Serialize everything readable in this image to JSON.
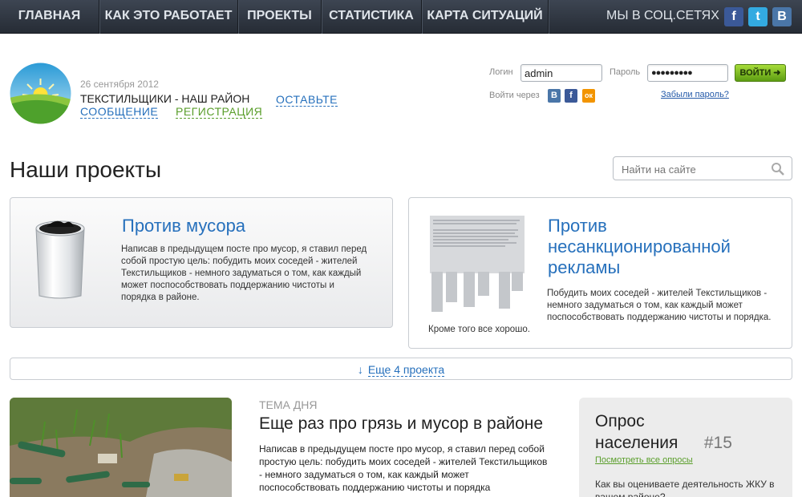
{
  "nav": {
    "items": [
      "ГЛАВНАЯ",
      "КАК ЭТО РАБОТАЕТ",
      "ПРОЕКТЫ",
      "СТАТИСТИКА",
      "КАРТА СИТУАЦИЙ"
    ],
    "social_label": "МЫ В СОЦ.СЕТЯХ",
    "social_icons": [
      {
        "name": "facebook-icon",
        "glyph": "f",
        "color": "#3b5998"
      },
      {
        "name": "twitter-icon",
        "glyph": "t",
        "color": "#33aae1"
      },
      {
        "name": "vkontakte-icon",
        "glyph": "B",
        "color": "#4a76a8"
      }
    ]
  },
  "header": {
    "date": "26 сентября 2012",
    "site_title": "ТЕКСТИЛЬЩИКИ - НАШ РАЙОН",
    "leave_label": "ОСТАВЬТЕ",
    "message_label": "СООБЩЕНИЕ",
    "register_label": "РЕГИСТРАЦИЯ"
  },
  "login": {
    "login_label": "Логин",
    "login_value": "admin",
    "password_label": "Пароль",
    "password_value": "●●●●●●●●●",
    "submit_label": "ВОЙТИ",
    "via_label": "Войти через",
    "via_icons": [
      {
        "name": "vkontakte-icon",
        "glyph": "B",
        "color": "#4a76a8"
      },
      {
        "name": "facebook-icon",
        "glyph": "f",
        "color": "#3b5998"
      },
      {
        "name": "odnoklassniki-icon",
        "glyph": "ок",
        "color": "#f29400"
      }
    ],
    "forgot_label": "Забыли пароль?"
  },
  "page": {
    "title": "Наши проекты",
    "search_placeholder": "Найти на сайте"
  },
  "projects": [
    {
      "title": "Против мусора",
      "text": "Написав в предыдущем посте про мусор, я ставил перед собой простую цель: побудить моих соседей - жителей Текстильщиков - немного задуматься о том, как каждый может поспособствовать поддержанию чистоты и порядка в районе."
    },
    {
      "title": "Против несанкционированной рекламы",
      "text": "Побудить моих соседей - жителей Текстильщиков - немного задуматься о том, как каждый может поспособствовать поддержанию чистоты и порядка.",
      "caption": "Кроме того все хорошо."
    }
  ],
  "more_projects": "Еще 4 проекта",
  "theme": {
    "label": "ТЕМА ДНЯ",
    "title": "Еще раз про грязь и мусор в районе",
    "text": "Написав в предыдущем посте про мусор, я ставил перед собой простую цель: побудить моих соседей - жителей Текстильщиков - немного задуматься о том, как каждый может поспособствовать поддержанию чистоты и порядка"
  },
  "poll": {
    "title": "Опрос населения",
    "number": "#15",
    "all_link": "Посмотреть все опросы",
    "question": "Как вы оцениваете деятельность ЖКУ в вашем районе?"
  },
  "colors": {
    "accent_blue": "#2670bc",
    "accent_green": "#5a9e2b",
    "nav_bg": "#2f3640"
  }
}
